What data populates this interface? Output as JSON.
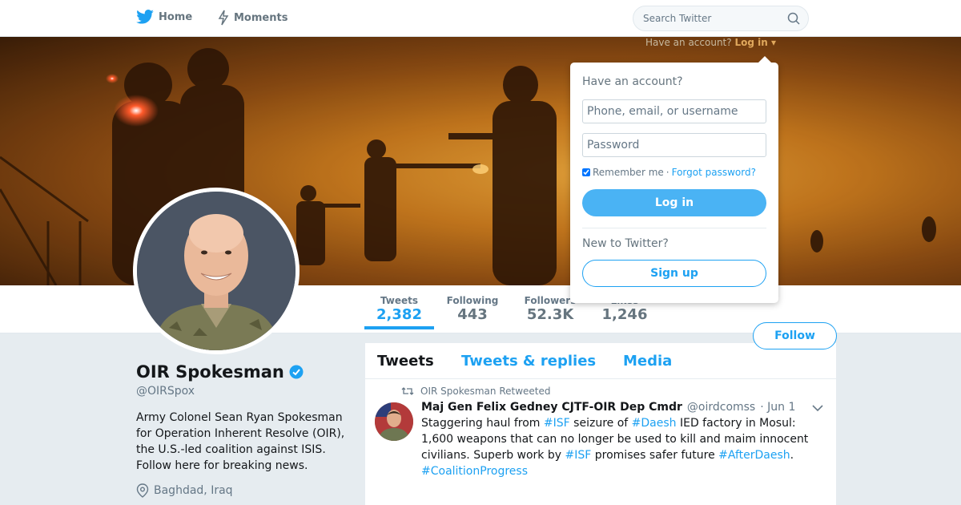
{
  "nav": {
    "home_label": "Home",
    "home_icon": "twitter-bird-icon",
    "moments_label": "Moments",
    "moments_icon": "lightning-icon",
    "search_placeholder": "Search Twitter",
    "search_icon": "search-icon"
  },
  "cover": {
    "login_hint_prefix": "Have an account?",
    "login_hint_link": "Log in ▾"
  },
  "stats": [
    {
      "label": "Tweets",
      "value": "2,382"
    },
    {
      "label": "Following",
      "value": "443"
    },
    {
      "label": "Followers",
      "value": "52.3K"
    },
    {
      "label": "Likes",
      "value": "1,246"
    }
  ],
  "follow_label": "Follow",
  "profile": {
    "name": "OIR Spokesman",
    "handle": "@OIRSpox",
    "bio": "Army Colonel Sean Ryan Spokesman for Operation Inherent Resolve (OIR), the U.S.-led coalition against ISIS. Follow here for breaking news.",
    "location": "Baghdad, Iraq"
  },
  "timeline": {
    "tabs": [
      "Tweets",
      "Tweets & replies",
      "Media"
    ],
    "tweet": {
      "retweeted_by": "OIR Spokesman Retweeted",
      "author": "Maj Gen Felix Gedney CJTF-OIR Dep Cmdr",
      "handle": "@oirdcomss",
      "time": "· Jun 1",
      "text": {
        "t1": "Staggering haul from ",
        "h1": "#ISF",
        "t2": " seizure of ",
        "h2": "#Daesh",
        "t3": " IED factory in Mosul: 1,600 weapons that can no longer be used to kill and maim innocent civilians. Superb work by ",
        "h3": "#ISF",
        "t4": " promises safer future ",
        "h4": "#AfterDaesh",
        "t5": ". ",
        "h5": "#CoalitionProgress"
      }
    }
  },
  "login": {
    "title": "Have an account?",
    "username_placeholder": "Phone, email, or username",
    "password_placeholder": "Password",
    "remember_label": "Remember me",
    "separator": "·",
    "forgot_label": "Forgot password?",
    "login_button": "Log in",
    "new_label": "New to Twitter?",
    "signup_button": "Sign up"
  },
  "colors": {
    "accent": "#1da1f2",
    "background": "#e6ecf0"
  }
}
